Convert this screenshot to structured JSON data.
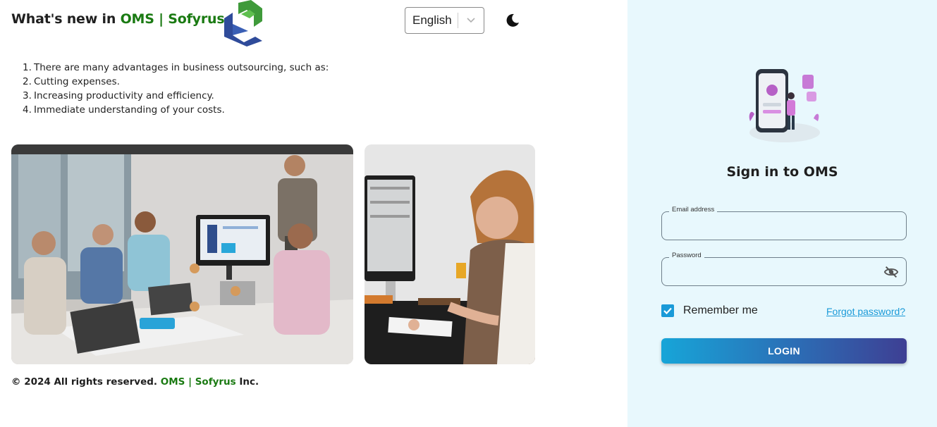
{
  "header": {
    "headline_prefix": "What's new in ",
    "headline_brand": "OMS | Sofyrus",
    "language": {
      "selected": "English"
    },
    "theme_toggle_icon": "moon-icon"
  },
  "advantages": [
    {
      "num": "1.",
      "text": "There are many advantages in business outsourcing, such as:"
    },
    {
      "num": "2.",
      "text": "Cutting expenses."
    },
    {
      "num": "3.",
      "text": "Increasing productivity and efficiency."
    },
    {
      "num": "4.",
      "text": "Immediate understanding of your costs."
    }
  ],
  "footer": {
    "prefix": "© 2024 All rights reserved. ",
    "brand": "OMS | Sofyrus",
    "suffix": " Inc."
  },
  "signin": {
    "title": "Sign in to OMS",
    "email_label": "Email address",
    "email_value": "",
    "password_label": "Password",
    "password_value": "",
    "password_toggle_icon": "eye-off-icon",
    "remember_label": "Remember me",
    "remember_checked": true,
    "forgot_label": "Forgot password?",
    "login_label": "LOGIN"
  },
  "colors": {
    "brand_green": "#1a7a12",
    "panel_bg": "#e8f8fd",
    "accent_blue": "#1a9ad8",
    "button_gradient_start": "#17a5d8",
    "button_gradient_end": "#3e3f93"
  }
}
